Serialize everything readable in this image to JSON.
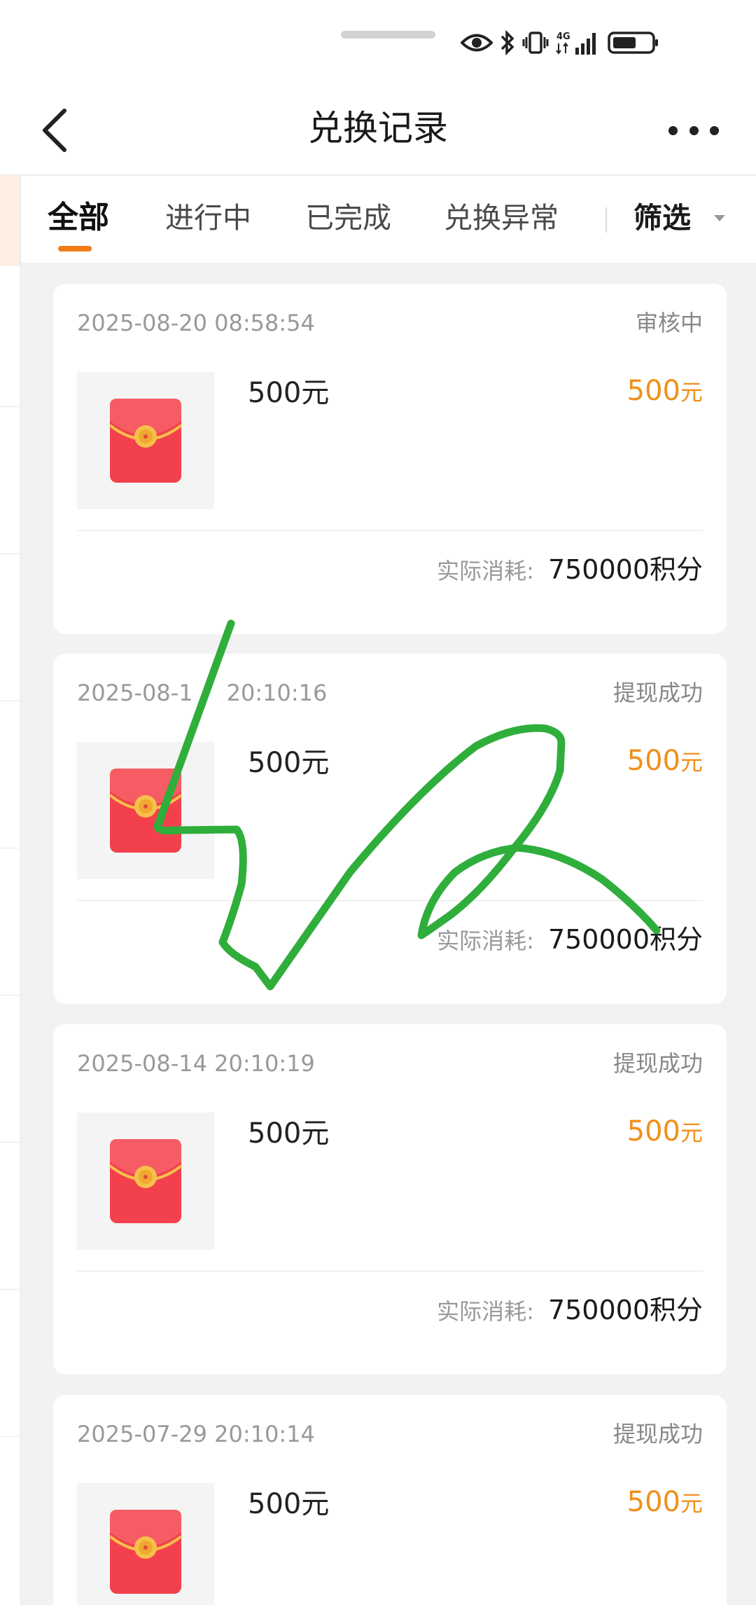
{
  "status_bar": {
    "icons": [
      "eye-icon",
      "bluetooth-icon",
      "vibrate-icon",
      "signal-4g-icon",
      "battery-icon"
    ],
    "network": "4G"
  },
  "header": {
    "title": "兑换记录",
    "back_icon": "chevron-left-icon",
    "more_icon": "more-dots-icon"
  },
  "tabs": [
    {
      "label": "全部",
      "active": true
    },
    {
      "label": "进行中",
      "active": false
    },
    {
      "label": "已完成",
      "active": false
    },
    {
      "label": "兑换异常",
      "active": false
    }
  ],
  "filter": {
    "label": "筛选"
  },
  "colors": {
    "accent": "#f07c18",
    "price": "#f0901c",
    "scribble": "#2fae3c",
    "envelope": "#f2414c"
  },
  "records": [
    {
      "date": "2025-08-20 08:58:54",
      "status": "审核中",
      "name": "500元",
      "price": "500",
      "price_unit": "元",
      "cost_label": "实际消耗:",
      "cost_value": "750000积分"
    },
    {
      "date": "2025-08-1",
      "date_tail": "20:10:16",
      "status": "提现成功",
      "name": "500元",
      "price": "500",
      "price_unit": "元",
      "cost_label": "实际消耗:",
      "cost_value": "750000积分"
    },
    {
      "date": "2025-08-14 20:10:19",
      "status": "提现成功",
      "name": "500元",
      "price": "500",
      "price_unit": "元",
      "cost_label": "实际消耗:",
      "cost_value": "750000积分"
    },
    {
      "date": "2025-07-29 20:10:14",
      "status": "提现成功",
      "name": "500元",
      "price": "500",
      "price_unit": "元",
      "cost_label": "",
      "cost_value": ""
    }
  ]
}
